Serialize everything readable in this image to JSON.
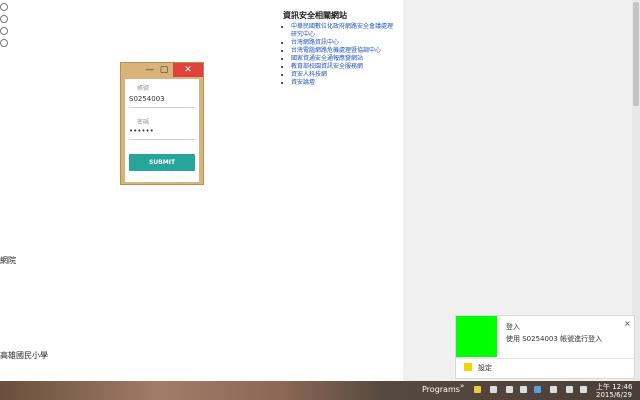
{
  "left_fragments": {
    "frag1": "網院",
    "frag2": "高雄國民小學"
  },
  "login": {
    "username_label": "帳號",
    "username_value": "S0254003",
    "password_label": "密碼",
    "password_value": "••••••",
    "submit_label": "SUBMIT",
    "window_min": "—",
    "window_max": "▢",
    "window_close": "✕"
  },
  "links": {
    "title": "資訊安全相關網站",
    "items": [
      "中華民國數位化政府網路安全會議處理研究中心",
      "台灣網路資訊中心",
      "台灣電腦網路危機處理暨協調中心",
      "國家資通安全通報應變網站",
      "教育部校園資訊安全服務網",
      "資安人科技網",
      "資安論壇"
    ]
  },
  "toast": {
    "title": "登入",
    "message": "使用 S0254003 帳號進行登入",
    "close": "×",
    "settings_label": "設定",
    "image_color": "#00ff00",
    "settings_icon_color": "#f2d600"
  },
  "taskbar": {
    "programs_label": "Programs",
    "chevron": "»",
    "clock_time": "上午 12:46",
    "clock_date": "2015/6/29"
  },
  "colors": {
    "accent": "#26a69a",
    "window_frame": "#d9b37a",
    "close_button": "#e0433c",
    "link": "#2255bb"
  }
}
